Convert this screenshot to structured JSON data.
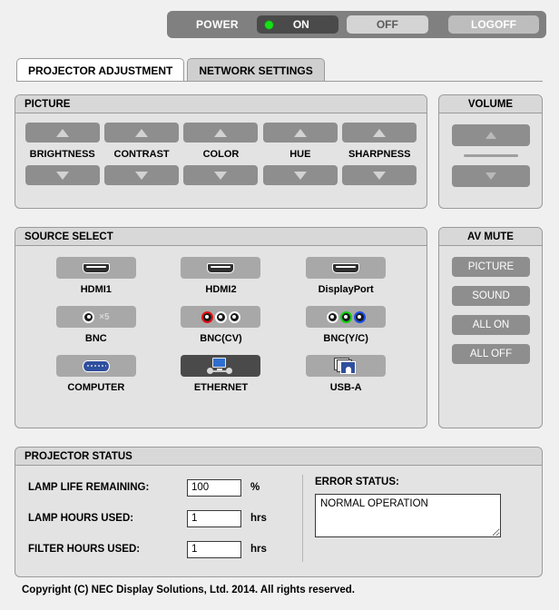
{
  "power": {
    "label": "POWER",
    "on_label": "ON",
    "off_label": "OFF",
    "logoff_label": "LOGOFF",
    "state": "ON",
    "led_color": "#16e016",
    "bar_color": "#808080"
  },
  "tabs": [
    {
      "label": "PROJECTOR ADJUSTMENT",
      "active": true
    },
    {
      "label": "NETWORK SETTINGS",
      "active": false
    }
  ],
  "picture": {
    "title": "PICTURE",
    "controls": [
      {
        "label": "BRIGHTNESS",
        "up_icon": "triangle-up-icon",
        "down_icon": "triangle-down-icon"
      },
      {
        "label": "CONTRAST",
        "up_icon": "triangle-up-icon",
        "down_icon": "triangle-down-icon"
      },
      {
        "label": "COLOR",
        "up_icon": "triangle-up-icon",
        "down_icon": "triangle-down-icon"
      },
      {
        "label": "HUE",
        "up_icon": "triangle-up-icon",
        "down_icon": "triangle-down-icon"
      },
      {
        "label": "SHARPNESS",
        "up_icon": "triangle-up-icon",
        "down_icon": "triangle-down-icon"
      }
    ]
  },
  "volume": {
    "title": "VOLUME",
    "up_icon": "triangle-up-icon",
    "down_icon": "triangle-down-icon"
  },
  "source_select": {
    "title": "SOURCE SELECT",
    "items": [
      {
        "label": "HDMI1",
        "icon": "hdmi-connector-icon",
        "selected": false
      },
      {
        "label": "HDMI2",
        "icon": "hdmi-connector-icon",
        "selected": false
      },
      {
        "label": "DisplayPort",
        "icon": "displayport-connector-icon",
        "selected": false
      },
      {
        "label": "BNC",
        "icon": "bnc-x5-icon",
        "selected": false
      },
      {
        "label": "BNC(CV)",
        "icon": "bnc-composite-icon",
        "selected": false
      },
      {
        "label": "BNC(Y/C)",
        "icon": "bnc-svideo-icon",
        "selected": false
      },
      {
        "label": "COMPUTER",
        "icon": "vga-connector-icon",
        "selected": false
      },
      {
        "label": "ETHERNET",
        "icon": "ethernet-network-icon",
        "selected": true
      },
      {
        "label": "USB-A",
        "icon": "usb-images-icon",
        "selected": false
      }
    ],
    "bnc_multiplier": "×5"
  },
  "av_mute": {
    "title": "AV MUTE",
    "buttons": [
      {
        "label": "PICTURE"
      },
      {
        "label": "SOUND"
      },
      {
        "label": "ALL ON"
      },
      {
        "label": "ALL OFF"
      }
    ]
  },
  "projector_status": {
    "title": "PROJECTOR STATUS",
    "rows": [
      {
        "label": "LAMP LIFE REMAINING:",
        "value": "100",
        "unit": "%"
      },
      {
        "label": "LAMP HOURS USED:",
        "value": "1",
        "unit": "hrs"
      },
      {
        "label": "FILTER HOURS USED:",
        "value": "1",
        "unit": "hrs"
      }
    ],
    "error_status_label": "ERROR STATUS:",
    "error_status_value": "NORMAL OPERATION"
  },
  "footer": {
    "copyright": "Copyright (C) NEC Display Solutions, Ltd. 2014. All rights reserved."
  }
}
